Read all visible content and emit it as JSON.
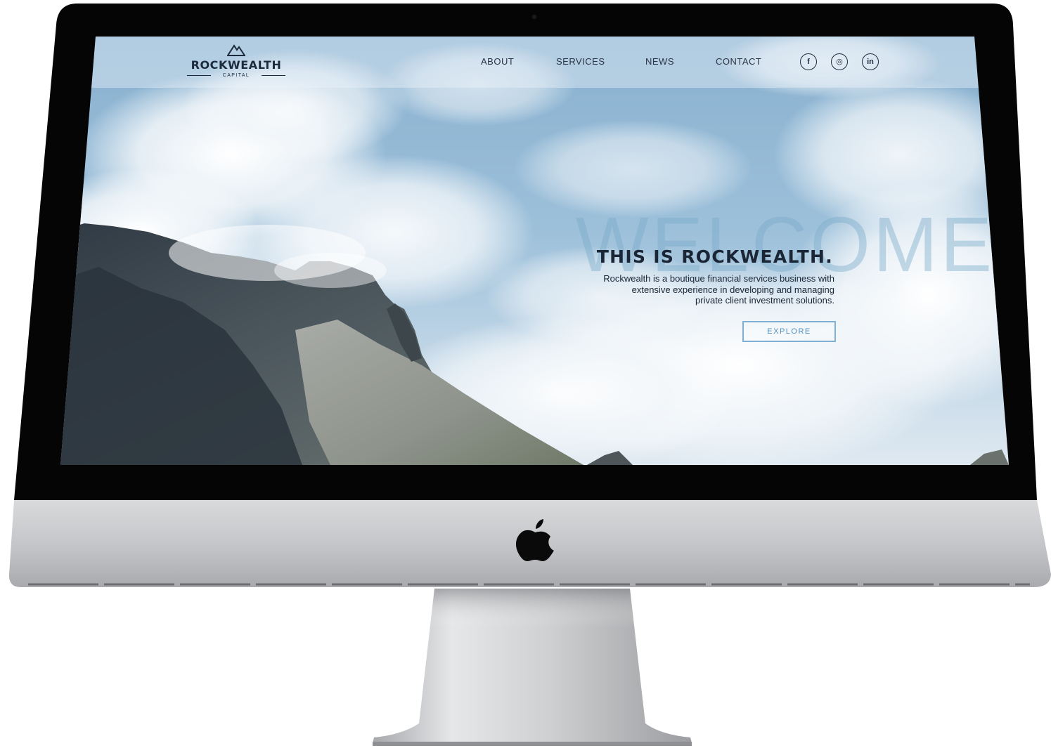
{
  "brand": {
    "name": "ROCKWEALTH",
    "subtitle": "CAPITAL",
    "logo_icon": "mountain-icon"
  },
  "nav": {
    "items": [
      {
        "label": "ABOUT"
      },
      {
        "label": "SERVICES"
      },
      {
        "label": "NEWS"
      },
      {
        "label": "CONTACT"
      }
    ]
  },
  "social": [
    {
      "icon": "facebook-icon",
      "glyph": "f"
    },
    {
      "icon": "instagram-icon",
      "glyph": "◎"
    },
    {
      "icon": "linkedin-icon",
      "glyph": "in"
    }
  ],
  "hero": {
    "background_word": "WELCOME",
    "title": "THIS IS ROCKWEALTH.",
    "description_lines": [
      "Rockwealth is a boutique financial services business with",
      "extensive experience in developing and managing",
      "private client investment solutions."
    ],
    "cta_label": "EXPLORE"
  },
  "colors": {
    "navy": "#1c2a3d",
    "accent_blue": "#7fb0d3",
    "sky": "#8bb4d2",
    "bezel": "#050505",
    "aluminum": "#c8c9cc"
  }
}
